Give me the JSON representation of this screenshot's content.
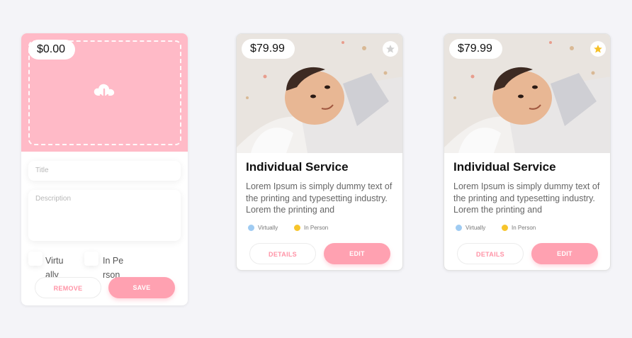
{
  "editor": {
    "price": "$0.00",
    "title_placeholder": "Title",
    "description_placeholder": "Description",
    "option_virtually": "Virtually",
    "option_in_person": "In Person",
    "remove_label": "REMOVE",
    "save_label": "SAVE"
  },
  "cards": [
    {
      "price": "$79.99",
      "title": "Individual Service",
      "description": "Lorem Ipsum is simply dummy text of the printing and typesetting industry. Lorem the printing and",
      "tag_virtually": "Virtually",
      "tag_in_person": "In Person",
      "details_label": "DETAILS",
      "edit_label": "EDIT",
      "favorited": false
    },
    {
      "price": "$79.99",
      "title": "Individual Service",
      "description": "Lorem Ipsum is simply dummy text of the printing and typesetting industry. Lorem the printing and",
      "tag_virtually": "Virtually",
      "tag_in_person": "In Person",
      "details_label": "DETAILS",
      "edit_label": "EDIT",
      "favorited": true
    }
  ],
  "colors": {
    "accent_pink": "#ffa1b1",
    "upload_bg": "#ffbac7",
    "virtually_dot": "#9fcbf2",
    "in_person_dot": "#f7c52c",
    "star_active": "#f6c026",
    "star_inactive": "#d0d0d0"
  },
  "icons": {
    "upload": "cloud-upload-icon",
    "favorite": "star-icon"
  }
}
